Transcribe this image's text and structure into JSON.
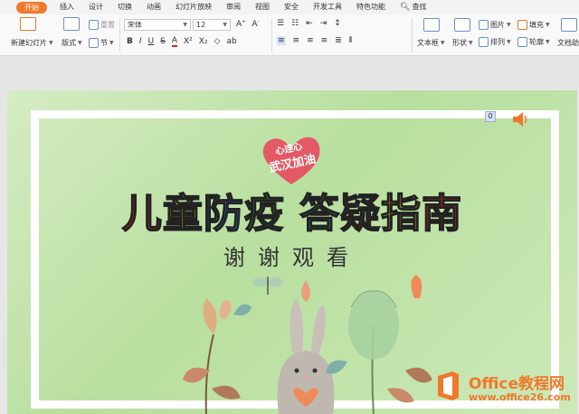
{
  "tabs": [
    "开始",
    "插入",
    "设计",
    "切换",
    "动画",
    "幻灯片放映",
    "审阅",
    "视图",
    "安全",
    "开发工具",
    "特色功能"
  ],
  "search_label": "查找",
  "ribbon": {
    "new_slide": "新建幻灯片",
    "layout": "版式",
    "section": "节",
    "reset": "重置",
    "font_name": "宋体",
    "font_size": "12",
    "textbox": "文本框",
    "shape": "形状",
    "arrange": "排列",
    "picture": "图片",
    "fill": "填充",
    "outline": "轮廓",
    "text_effect": "文档助手"
  },
  "slide": {
    "title_chars": [
      {
        "t": "儿",
        "color": "#e8271d"
      },
      {
        "t": "童",
        "color": "#f0c419"
      },
      {
        "t": "防",
        "color": "#2f7fd8"
      },
      {
        "t": "疫",
        "color": "#3bb24a"
      },
      {
        "t": " ",
        "color": "#000000"
      },
      {
        "t": "答",
        "color": "#3bb24a"
      },
      {
        "t": "疑",
        "color": "#e8271d"
      },
      {
        "t": "指",
        "color": "#f0c419"
      },
      {
        "t": "南",
        "color": "#e8271d"
      }
    ],
    "subtitle": "谢谢观看",
    "logo_line1": "心连心",
    "logo_line2": "武汉加油",
    "slide_number": "0"
  },
  "watermark": {
    "title": "Office教程网",
    "url": "www.office26.com"
  },
  "colors": {
    "accent": "#f07a2c",
    "slide_bg": "#c6e6b0"
  }
}
